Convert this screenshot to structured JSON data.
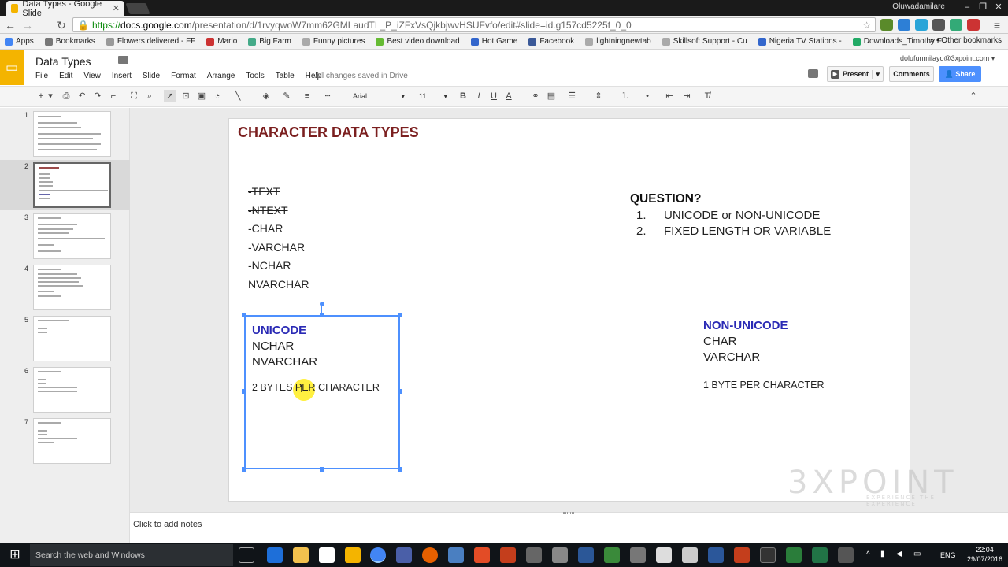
{
  "browser": {
    "tab_title": "Data Types - Google Slide",
    "user_name": "Oluwadamilare",
    "url_https": "https://",
    "url_host": "docs.google.com",
    "url_path": "/presentation/d/1rvyqwoW7mm62GMLaudTL_P_iZFxVsQjkbjwvHSUFvfo/edit#slide=id.g157cd5225f_0_0",
    "bookmarks": [
      "Apps",
      "Bookmarks",
      "Flowers delivered - FF",
      "Mario",
      "Big Farm",
      "Funny pictures",
      "Best video download",
      "Hot Game",
      "Facebook",
      "lightningnewtab",
      "Skillsoft Support - Cu",
      "Nigeria TV Stations -",
      "Downloads_Timothy F"
    ],
    "other_bookmarks": "Other bookmarks"
  },
  "docs": {
    "title": "Data Types",
    "menus": [
      "File",
      "Edit",
      "View",
      "Insert",
      "Slide",
      "Format",
      "Arrange",
      "Tools",
      "Table",
      "Help"
    ],
    "saved_status": "All changes saved in Drive",
    "account_email": "dolufunmilayo@3xpoint.com",
    "present_label": "Present",
    "comments_label": "Comments",
    "share_label": "Share",
    "font": "Arial",
    "font_size": "11"
  },
  "filmstrip": {
    "slide_numbers": [
      "1",
      "2",
      "3",
      "4",
      "5",
      "6",
      "7"
    ],
    "selected": "2"
  },
  "slide": {
    "title": "CHARACTER DATA TYPES",
    "types": [
      {
        "text": "-TEXT",
        "strike": true
      },
      {
        "text": "-NTEXT",
        "strike": true
      },
      {
        "text": "-CHAR",
        "strike": false
      },
      {
        "text": "-VARCHAR",
        "strike": false
      },
      {
        "text": "-NCHAR",
        "strike": false
      },
      {
        "text": "NVARCHAR",
        "strike": false
      }
    ],
    "question_heading": "QUESTION?",
    "questions": [
      {
        "num": "1.",
        "text": "UNICODE or NON-UNICODE"
      },
      {
        "num": "2.",
        "text": "FIXED LENGTH OR VARIABLE"
      }
    ],
    "unicode": {
      "heading": "UNICODE",
      "items": [
        "NCHAR",
        "NVARCHAR"
      ],
      "bytes": "2 BYTES PER CHARACTER"
    },
    "non_unicode": {
      "heading": "NON-UNICODE",
      "items": [
        "CHAR",
        "VARCHAR"
      ],
      "bytes": "1 BYTE PER CHARACTER"
    },
    "watermark": "3XPOINT",
    "watermark_tagline": "EXPERIENCE THE EXPERIENCE"
  },
  "notes_placeholder": "Click to add notes",
  "taskbar": {
    "search_placeholder": "Search the web and Windows",
    "language": "ENG",
    "time": "22:04",
    "date": "29/07/2016"
  }
}
